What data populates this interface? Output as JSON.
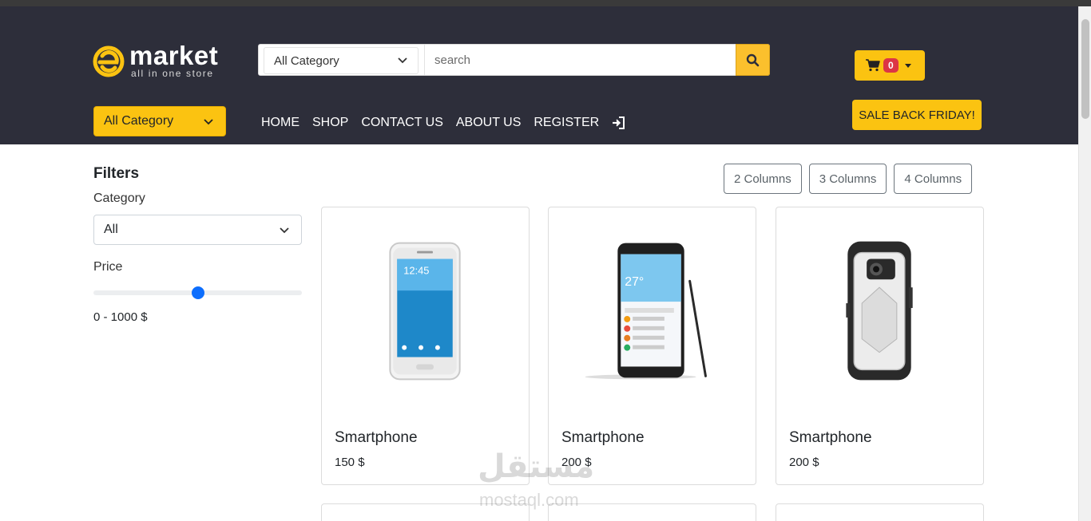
{
  "brand": {
    "name": "market",
    "tagline": "all in one store",
    "logo_icon": "e-logo-icon"
  },
  "search": {
    "category_selected": "All Category",
    "placeholder": "search"
  },
  "cart": {
    "count": "0"
  },
  "nav": {
    "category_selected": "All Category",
    "links": [
      "HOME",
      "SHOP",
      "CONTACT US",
      "ABOUT US",
      "REGISTER"
    ],
    "login_icon": "sign-in-icon",
    "sale_label": "SALE BACK FRIDAY!"
  },
  "filters": {
    "title": "Filters",
    "category_label": "Category",
    "category_selected": "All",
    "price_label": "Price",
    "price_slider_fraction": 0.5,
    "price_range_text": "0 - 1000 $"
  },
  "columns": {
    "buttons": [
      "2 Columns",
      "3 Columns",
      "4 Columns"
    ]
  },
  "products": [
    {
      "name": "Smartphone",
      "price": "150 $",
      "image": "white-smartphone"
    },
    {
      "name": "Smartphone",
      "price": "200 $",
      "image": "black-smartphone-with-stylus"
    },
    {
      "name": "Smartphone",
      "price": "200 $",
      "image": "white-rugged-phone-case"
    }
  ],
  "watermark": {
    "arabic": "مستقل",
    "latin": "mostaql.com"
  },
  "colors": {
    "header_bg": "#2d2e3a",
    "accent_yellow": "#fbc311",
    "badge_red": "#dc3545",
    "slider_blue": "#0d6efd"
  }
}
